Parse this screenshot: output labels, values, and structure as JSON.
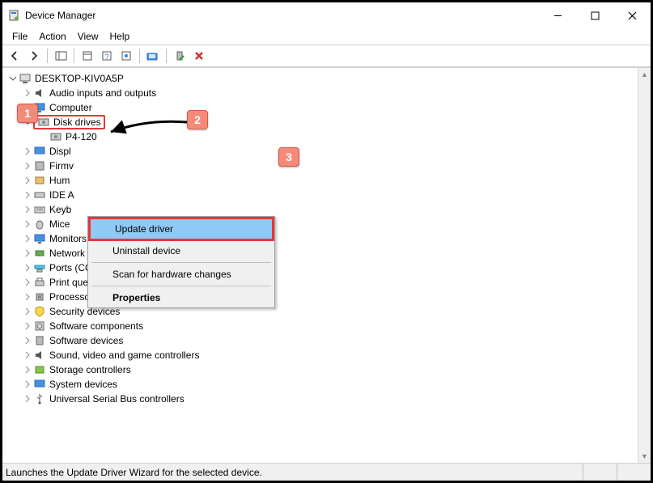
{
  "window": {
    "title": "Device Manager"
  },
  "menubar": {
    "file": "File",
    "action": "Action",
    "view": "View",
    "help": "Help"
  },
  "tree": {
    "root": "DESKTOP-KIV0A5P",
    "categories": [
      "Audio inputs and outputs",
      "Computer",
      "Disk drives",
      "Display adapters",
      "Firmware",
      "Human Interface Devices",
      "IDE ATA/ATAPI controllers",
      "Keyboards",
      "Mice and other pointing devices",
      "Monitors",
      "Network adapters",
      "Ports (COM & LPT)",
      "Print queues",
      "Processors",
      "Security devices",
      "Software components",
      "Software devices",
      "Sound, video and game controllers",
      "Storage controllers",
      "System devices",
      "Universal Serial Bus controllers"
    ],
    "visible_categories": {
      "audio": "Audio inputs and outputs",
      "computer": "Computer",
      "disk": "Disk drives",
      "display_short": "Displ",
      "firmware_short": "Firmv",
      "hid_short": "Hum",
      "ide_short": "IDE A",
      "keyboard_short": "Keyb",
      "mice_short": "Mice",
      "monitors": "Monitors",
      "network": "Network adapters",
      "ports": "Ports (COM & LPT)",
      "printq": "Print queues",
      "processors": "Processors",
      "security": "Security devices",
      "softcomp": "Software components",
      "softdev": "Software devices",
      "sound": "Sound, video and game controllers",
      "storage": "Storage controllers",
      "system": "System devices",
      "usb": "Universal Serial Bus controllers"
    },
    "selected_device": "P4-120"
  },
  "context_menu": {
    "update": "Update driver",
    "uninstall": "Uninstall device",
    "scan": "Scan for hardware changes",
    "properties": "Properties"
  },
  "statusbar": {
    "text": "Launches the Update Driver Wizard for the selected device."
  },
  "annotations": {
    "c1": "1",
    "c2": "2",
    "c3": "3"
  }
}
